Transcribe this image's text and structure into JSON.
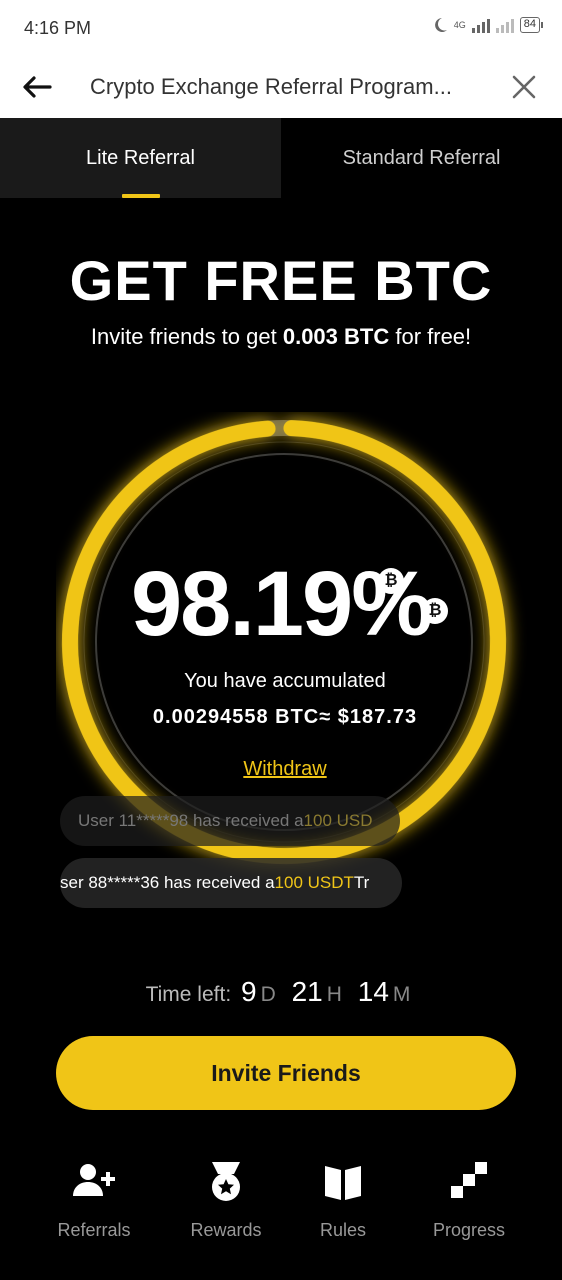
{
  "status_bar": {
    "time": "4:16 PM",
    "network": "4G",
    "battery": "84"
  },
  "header": {
    "title": "Crypto Exchange Referral Program..."
  },
  "tabs": [
    {
      "label": "Lite Referral",
      "active": true
    },
    {
      "label": "Standard Referral",
      "active": false
    }
  ],
  "hero": {
    "title": "GET FREE BTC",
    "subtitle_prefix": "Invite friends to get ",
    "subtitle_amount": "0.003 BTC",
    "subtitle_suffix": " for free!"
  },
  "progress": {
    "percent_text": "98.19%",
    "fraction": 0.9819,
    "coin_symbol": "₿",
    "accumulated_label": "You have accumulated",
    "accumulated_value": "0.00294558 BTC≈ $187.73",
    "withdraw_label": "Withdraw"
  },
  "ticker": [
    {
      "prefix": "User 11*****98 has received a ",
      "amount": "100 USD",
      "suffix": ""
    },
    {
      "prefix": "ser 88*****36 has received a ",
      "amount": "100 USDT",
      "suffix": " Tr"
    }
  ],
  "countdown": {
    "label": "Time left:",
    "days": "9",
    "days_unit": "D",
    "hours": "21",
    "hours_unit": "H",
    "minutes": "14",
    "minutes_unit": "M"
  },
  "invite_button": {
    "label": "Invite Friends"
  },
  "bottom_nav": [
    {
      "label": "Referrals",
      "icon": "add-user-icon"
    },
    {
      "label": "Rewards",
      "icon": "medal-icon"
    },
    {
      "label": "Rules",
      "icon": "book-icon"
    },
    {
      "label": "Progress",
      "icon": "steps-icon"
    }
  ],
  "colors": {
    "accent": "#f0c517",
    "background": "#000000",
    "tab_active_bg": "#1a1a1a"
  }
}
